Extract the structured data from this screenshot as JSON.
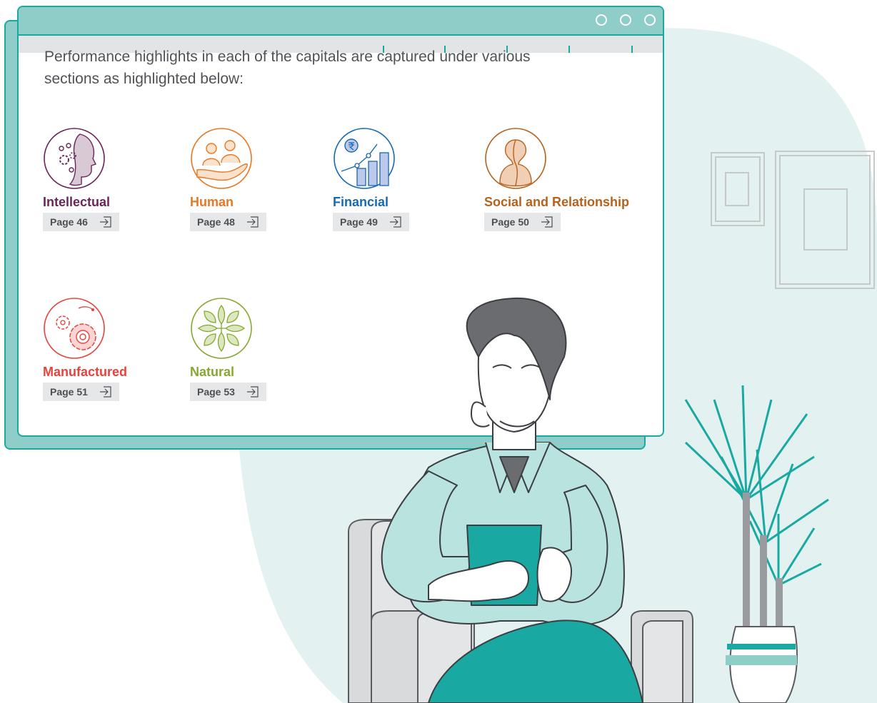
{
  "window": {
    "intro": "Performance highlights in each of the capitals are captured under various sections as highlighted below:",
    "dots": [
      "window-control-1",
      "window-control-2",
      "window-control-3"
    ]
  },
  "capitals": [
    {
      "name": "Intellectual",
      "page": "Page 46",
      "color": "#6b2458",
      "icon": "intellectual-capital-icon"
    },
    {
      "name": "Human",
      "page": "Page 48",
      "color": "#e87722",
      "icon": "human-capital-icon"
    },
    {
      "name": "Financial",
      "page": "Page 49",
      "color": "#1768b5",
      "icon": "financial-capital-icon"
    },
    {
      "name": "Social and Relationship",
      "page": "Page 50",
      "color": "#b8611b",
      "icon": "social-relationship-capital-icon"
    },
    {
      "name": "Manufactured",
      "page": "Page 51",
      "color": "#e6433c",
      "icon": "manufactured-capital-icon"
    },
    {
      "name": "Natural",
      "page": "Page 53",
      "color": "#86a830",
      "icon": "natural-capital-icon"
    }
  ],
  "colors": {
    "accent": "#1aa9a2",
    "titlebar": "#8ecdc8",
    "blob": "#e3f2f0"
  }
}
